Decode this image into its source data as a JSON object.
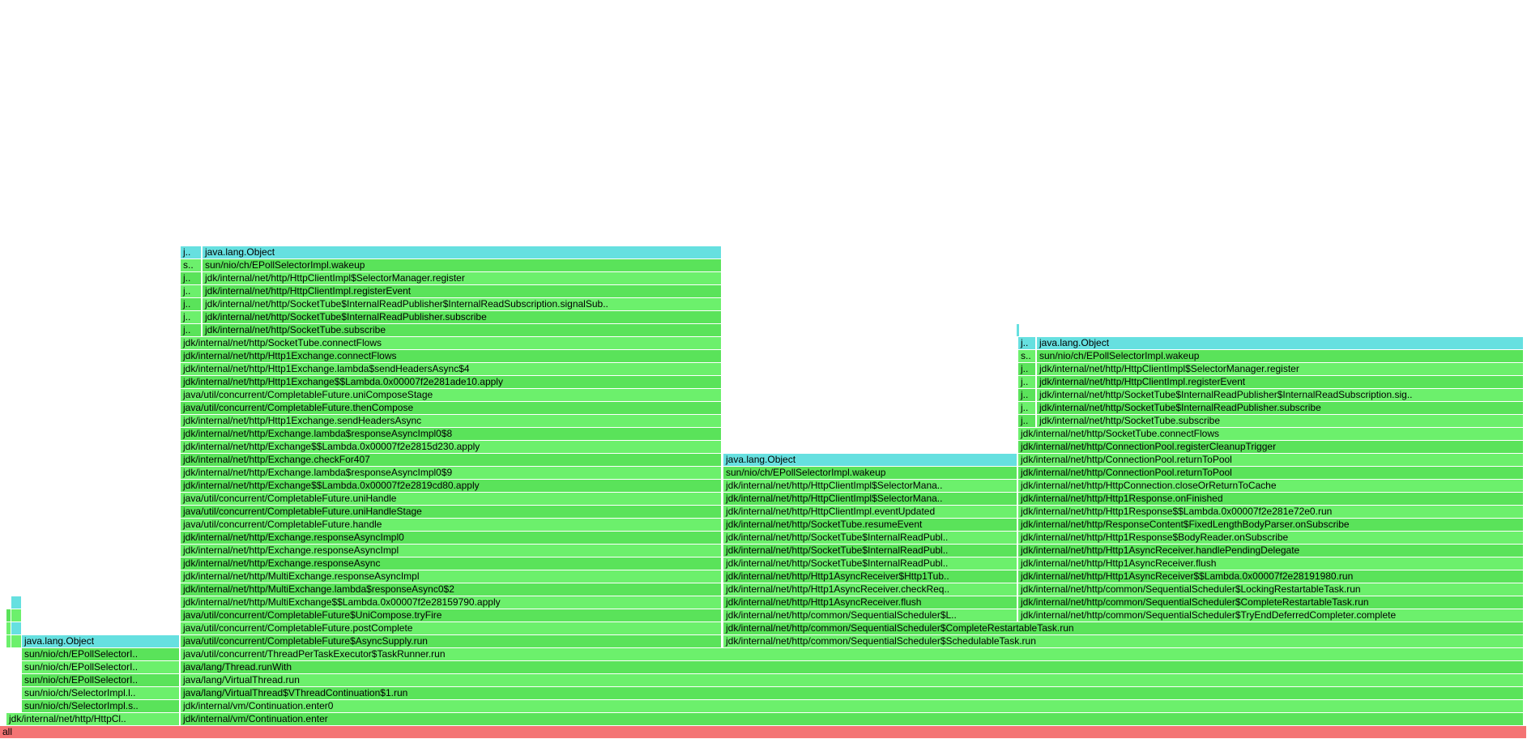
{
  "chart_data": {
    "type": "flamegraph",
    "title": "",
    "total_samples": 1885,
    "colors": {
      "java": "#6cf06c",
      "java_alt": "#5ae35a",
      "lock": "#66e0e0",
      "root": "#f47474"
    },
    "frames": [
      {
        "name": "all",
        "depth": 0,
        "start": 0,
        "width": 1885,
        "kind": "root"
      },
      {
        "name": "jdk/internal/net/http/HttpCl..",
        "depth": 1,
        "start": 8,
        "width": 214,
        "kind": "java"
      },
      {
        "name": "sun/nio/ch/SelectorImpl.s..",
        "depth": 2,
        "start": 27,
        "width": 195,
        "kind": "java_alt"
      },
      {
        "name": "sun/nio/ch/SelectorImpl.l..",
        "depth": 3,
        "start": 27,
        "width": 195,
        "kind": "java"
      },
      {
        "name": "sun/nio/ch/EPollSelectorI..",
        "depth": 4,
        "start": 27,
        "width": 195,
        "kind": "java_alt"
      },
      {
        "name": "sun/nio/ch/EPollSelectorI..",
        "depth": 5,
        "start": 27,
        "width": 195,
        "kind": "java"
      },
      {
        "name": "sun/nio/ch/EPollSelectorI..",
        "depth": 6,
        "start": 27,
        "width": 195,
        "kind": "java_alt"
      },
      {
        "name": "java.lang.Object",
        "depth": 7,
        "start": 27,
        "width": 195,
        "kind": "lock"
      },
      {
        "name": "",
        "depth": 7,
        "start": 8,
        "width": 6,
        "kind": "java"
      },
      {
        "name": "",
        "depth": 8,
        "start": 8,
        "width": 6,
        "kind": "java"
      },
      {
        "name": "",
        "depth": 9,
        "start": 8,
        "width": 6,
        "kind": "java_alt"
      },
      {
        "name": "",
        "depth": 7,
        "start": 14,
        "width": 13,
        "kind": "java"
      },
      {
        "name": "",
        "depth": 8,
        "start": 14,
        "width": 13,
        "kind": "lock"
      },
      {
        "name": "",
        "depth": 9,
        "start": 14,
        "width": 13,
        "kind": "java"
      },
      {
        "name": "",
        "depth": 10,
        "start": 14,
        "width": 13,
        "kind": "lock"
      },
      {
        "name": "jdk/internal/vm/Continuation.enter",
        "depth": 1,
        "start": 223,
        "width": 1658,
        "kind": "java_alt"
      },
      {
        "name": "jdk/internal/vm/Continuation.enter0",
        "depth": 2,
        "start": 223,
        "width": 1658,
        "kind": "java"
      },
      {
        "name": "java/lang/VirtualThread$VThreadContinuation$1.run",
        "depth": 3,
        "start": 223,
        "width": 1658,
        "kind": "java_alt"
      },
      {
        "name": "java/lang/VirtualThread.run",
        "depth": 4,
        "start": 223,
        "width": 1658,
        "kind": "java"
      },
      {
        "name": "java/lang/Thread.runWith",
        "depth": 5,
        "start": 223,
        "width": 1658,
        "kind": "java_alt"
      },
      {
        "name": "java/util/concurrent/ThreadPerTaskExecutor$TaskRunner.run",
        "depth": 6,
        "start": 223,
        "width": 1658,
        "kind": "java"
      },
      {
        "name": "java/util/concurrent/CompletableFuture$AsyncSupply.run",
        "depth": 7,
        "start": 223,
        "width": 668,
        "kind": "java_alt"
      },
      {
        "name": "java/util/concurrent/CompletableFuture.postComplete",
        "depth": 8,
        "start": 223,
        "width": 668,
        "kind": "java"
      },
      {
        "name": "java/util/concurrent/CompletableFuture$UniCompose.tryFire",
        "depth": 9,
        "start": 223,
        "width": 668,
        "kind": "java_alt"
      },
      {
        "name": "jdk/internal/net/http/MultiExchange$$Lambda.0x00007f2e28159790.apply",
        "depth": 10,
        "start": 223,
        "width": 668,
        "kind": "java"
      },
      {
        "name": "jdk/internal/net/http/MultiExchange.lambda$responseAsync0$2",
        "depth": 11,
        "start": 223,
        "width": 668,
        "kind": "java_alt"
      },
      {
        "name": "jdk/internal/net/http/MultiExchange.responseAsyncImpl",
        "depth": 12,
        "start": 223,
        "width": 668,
        "kind": "java"
      },
      {
        "name": "jdk/internal/net/http/Exchange.responseAsync",
        "depth": 13,
        "start": 223,
        "width": 668,
        "kind": "java_alt"
      },
      {
        "name": "jdk/internal/net/http/Exchange.responseAsyncImpl",
        "depth": 14,
        "start": 223,
        "width": 668,
        "kind": "java"
      },
      {
        "name": "jdk/internal/net/http/Exchange.responseAsyncImpl0",
        "depth": 15,
        "start": 223,
        "width": 668,
        "kind": "java_alt"
      },
      {
        "name": "java/util/concurrent/CompletableFuture.handle",
        "depth": 16,
        "start": 223,
        "width": 668,
        "kind": "java"
      },
      {
        "name": "java/util/concurrent/CompletableFuture.uniHandleStage",
        "depth": 17,
        "start": 223,
        "width": 668,
        "kind": "java_alt"
      },
      {
        "name": "java/util/concurrent/CompletableFuture.uniHandle",
        "depth": 18,
        "start": 223,
        "width": 668,
        "kind": "java"
      },
      {
        "name": "jdk/internal/net/http/Exchange$$Lambda.0x00007f2e2819cd80.apply",
        "depth": 19,
        "start": 223,
        "width": 668,
        "kind": "java_alt"
      },
      {
        "name": "jdk/internal/net/http/Exchange.lambda$responseAsyncImpl0$9",
        "depth": 20,
        "start": 223,
        "width": 668,
        "kind": "java"
      },
      {
        "name": "jdk/internal/net/http/Exchange.checkFor407",
        "depth": 21,
        "start": 223,
        "width": 668,
        "kind": "java_alt"
      },
      {
        "name": "jdk/internal/net/http/Exchange$$Lambda.0x00007f2e2815d230.apply",
        "depth": 22,
        "start": 223,
        "width": 668,
        "kind": "java"
      },
      {
        "name": "jdk/internal/net/http/Exchange.lambda$responseAsyncImpl0$8",
        "depth": 23,
        "start": 223,
        "width": 668,
        "kind": "java_alt"
      },
      {
        "name": "jdk/internal/net/http/Http1Exchange.sendHeadersAsync",
        "depth": 24,
        "start": 223,
        "width": 668,
        "kind": "java"
      },
      {
        "name": "java/util/concurrent/CompletableFuture.thenCompose",
        "depth": 25,
        "start": 223,
        "width": 668,
        "kind": "java_alt"
      },
      {
        "name": "java/util/concurrent/CompletableFuture.uniComposeStage",
        "depth": 26,
        "start": 223,
        "width": 668,
        "kind": "java"
      },
      {
        "name": "jdk/internal/net/http/Http1Exchange$$Lambda.0x00007f2e281ade10.apply",
        "depth": 27,
        "start": 223,
        "width": 668,
        "kind": "java_alt"
      },
      {
        "name": "jdk/internal/net/http/Http1Exchange.lambda$sendHeadersAsync$4",
        "depth": 28,
        "start": 223,
        "width": 668,
        "kind": "java"
      },
      {
        "name": "jdk/internal/net/http/Http1Exchange.connectFlows",
        "depth": 29,
        "start": 223,
        "width": 668,
        "kind": "java_alt"
      },
      {
        "name": "jdk/internal/net/http/SocketTube.connectFlows",
        "depth": 30,
        "start": 223,
        "width": 668,
        "kind": "java"
      },
      {
        "name": "j..",
        "depth": 31,
        "start": 223,
        "width": 26,
        "kind": "java_alt"
      },
      {
        "name": "jdk/internal/net/http/SocketTube.subscribe",
        "depth": 31,
        "start": 250,
        "width": 641,
        "kind": "java_alt"
      },
      {
        "name": "j..",
        "depth": 32,
        "start": 223,
        "width": 26,
        "kind": "java"
      },
      {
        "name": "jdk/internal/net/http/SocketTube$InternalReadPublisher.subscribe",
        "depth": 32,
        "start": 250,
        "width": 641,
        "kind": "java_alt"
      },
      {
        "name": "j..",
        "depth": 33,
        "start": 223,
        "width": 26,
        "kind": "java_alt"
      },
      {
        "name": "jdk/internal/net/http/SocketTube$InternalReadPublisher$InternalReadSubscription.signalSub..",
        "depth": 33,
        "start": 250,
        "width": 641,
        "kind": "java"
      },
      {
        "name": "j..",
        "depth": 34,
        "start": 223,
        "width": 26,
        "kind": "java"
      },
      {
        "name": "jdk/internal/net/http/HttpClientImpl.registerEvent",
        "depth": 34,
        "start": 250,
        "width": 641,
        "kind": "java_alt"
      },
      {
        "name": "j..",
        "depth": 35,
        "start": 223,
        "width": 26,
        "kind": "java_alt"
      },
      {
        "name": "jdk/internal/net/http/HttpClientImpl$SelectorManager.register",
        "depth": 35,
        "start": 250,
        "width": 641,
        "kind": "java"
      },
      {
        "name": "s..",
        "depth": 36,
        "start": 223,
        "width": 26,
        "kind": "java"
      },
      {
        "name": "sun/nio/ch/EPollSelectorImpl.wakeup",
        "depth": 36,
        "start": 250,
        "width": 641,
        "kind": "java_alt"
      },
      {
        "name": "j..",
        "depth": 37,
        "start": 223,
        "width": 26,
        "kind": "lock"
      },
      {
        "name": "java.lang.Object",
        "depth": 37,
        "start": 250,
        "width": 641,
        "kind": "lock"
      },
      {
        "name": "jdk/internal/net/http/common/SequentialScheduler$SchedulableTask.run",
        "depth": 7,
        "start": 893,
        "width": 988,
        "kind": "java"
      },
      {
        "name": "jdk/internal/net/http/common/SequentialScheduler$CompleteRestartableTask.run",
        "depth": 8,
        "start": 893,
        "width": 988,
        "kind": "java_alt"
      },
      {
        "name": "jdk/internal/net/http/common/SequentialScheduler$L..",
        "depth": 9,
        "start": 893,
        "width": 363,
        "kind": "java"
      },
      {
        "name": "jdk/internal/net/http/Http1AsyncReceiver.flush",
        "depth": 10,
        "start": 893,
        "width": 363,
        "kind": "java_alt"
      },
      {
        "name": "jdk/internal/net/http/Http1AsyncReceiver.checkReq..",
        "depth": 11,
        "start": 893,
        "width": 363,
        "kind": "java"
      },
      {
        "name": "jdk/internal/net/http/Http1AsyncReceiver$Http1Tub..",
        "depth": 12,
        "start": 893,
        "width": 363,
        "kind": "java_alt"
      },
      {
        "name": "jdk/internal/net/http/SocketTube$InternalReadPubl..",
        "depth": 13,
        "start": 893,
        "width": 363,
        "kind": "java"
      },
      {
        "name": "jdk/internal/net/http/SocketTube$InternalReadPubl..",
        "depth": 14,
        "start": 893,
        "width": 363,
        "kind": "java_alt"
      },
      {
        "name": "jdk/internal/net/http/SocketTube$InternalReadPubl..",
        "depth": 15,
        "start": 893,
        "width": 363,
        "kind": "java"
      },
      {
        "name": "jdk/internal/net/http/SocketTube.resumeEvent",
        "depth": 16,
        "start": 893,
        "width": 363,
        "kind": "java_alt"
      },
      {
        "name": "jdk/internal/net/http/HttpClientImpl.eventUpdated",
        "depth": 17,
        "start": 893,
        "width": 363,
        "kind": "java"
      },
      {
        "name": "jdk/internal/net/http/HttpClientImpl$SelectorMana..",
        "depth": 18,
        "start": 893,
        "width": 363,
        "kind": "java_alt"
      },
      {
        "name": "jdk/internal/net/http/HttpClientImpl$SelectorMana..",
        "depth": 19,
        "start": 893,
        "width": 363,
        "kind": "java"
      },
      {
        "name": "sun/nio/ch/EPollSelectorImpl.wakeup",
        "depth": 20,
        "start": 893,
        "width": 363,
        "kind": "java_alt"
      },
      {
        "name": "java.lang.Object",
        "depth": 21,
        "start": 893,
        "width": 363,
        "kind": "lock"
      },
      {
        "name": "jdk/internal/net/http/common/SequentialScheduler$TryEndDeferredCompleter.complete",
        "depth": 9,
        "start": 1257,
        "width": 624,
        "kind": "java"
      },
      {
        "name": "jdk/internal/net/http/common/SequentialScheduler$CompleteRestartableTask.run",
        "depth": 10,
        "start": 1257,
        "width": 624,
        "kind": "java_alt"
      },
      {
        "name": "jdk/internal/net/http/common/SequentialScheduler$LockingRestartableTask.run",
        "depth": 11,
        "start": 1257,
        "width": 624,
        "kind": "java"
      },
      {
        "name": "jdk/internal/net/http/Http1AsyncReceiver$$Lambda.0x00007f2e28191980.run",
        "depth": 12,
        "start": 1257,
        "width": 624,
        "kind": "java_alt"
      },
      {
        "name": "jdk/internal/net/http/Http1AsyncReceiver.flush",
        "depth": 13,
        "start": 1257,
        "width": 624,
        "kind": "java"
      },
      {
        "name": "jdk/internal/net/http/Http1AsyncReceiver.handlePendingDelegate",
        "depth": 14,
        "start": 1257,
        "width": 624,
        "kind": "java_alt"
      },
      {
        "name": "jdk/internal/net/http/Http1Response$BodyReader.onSubscribe",
        "depth": 15,
        "start": 1257,
        "width": 624,
        "kind": "java"
      },
      {
        "name": "jdk/internal/net/http/ResponseContent$FixedLengthBodyParser.onSubscribe",
        "depth": 16,
        "start": 1257,
        "width": 624,
        "kind": "java_alt"
      },
      {
        "name": "jdk/internal/net/http/Http1Response$$Lambda.0x00007f2e281e72e0.run",
        "depth": 17,
        "start": 1257,
        "width": 624,
        "kind": "java"
      },
      {
        "name": "jdk/internal/net/http/Http1Response.onFinished",
        "depth": 18,
        "start": 1257,
        "width": 624,
        "kind": "java_alt"
      },
      {
        "name": "jdk/internal/net/http/HttpConnection.closeOrReturnToCache",
        "depth": 19,
        "start": 1257,
        "width": 624,
        "kind": "java"
      },
      {
        "name": "jdk/internal/net/http/ConnectionPool.returnToPool",
        "depth": 20,
        "start": 1257,
        "width": 624,
        "kind": "java_alt"
      },
      {
        "name": "jdk/internal/net/http/ConnectionPool.returnToPool",
        "depth": 21,
        "start": 1257,
        "width": 624,
        "kind": "java"
      },
      {
        "name": "jdk/internal/net/http/ConnectionPool.registerCleanupTrigger",
        "depth": 22,
        "start": 1257,
        "width": 624,
        "kind": "java_alt"
      },
      {
        "name": "jdk/internal/net/http/SocketTube.connectFlows",
        "depth": 23,
        "start": 1257,
        "width": 624,
        "kind": "java"
      },
      {
        "name": "j..",
        "depth": 24,
        "start": 1257,
        "width": 22,
        "kind": "java_alt"
      },
      {
        "name": "jdk/internal/net/http/SocketTube.subscribe",
        "depth": 24,
        "start": 1280,
        "width": 601,
        "kind": "java"
      },
      {
        "name": "j..",
        "depth": 25,
        "start": 1257,
        "width": 22,
        "kind": "java"
      },
      {
        "name": "jdk/internal/net/http/SocketTube$InternalReadPublisher.subscribe",
        "depth": 25,
        "start": 1280,
        "width": 601,
        "kind": "java_alt"
      },
      {
        "name": "j..",
        "depth": 26,
        "start": 1257,
        "width": 22,
        "kind": "java_alt"
      },
      {
        "name": "jdk/internal/net/http/SocketTube$InternalReadPublisher$InternalReadSubscription.sig..",
        "depth": 26,
        "start": 1280,
        "width": 601,
        "kind": "java"
      },
      {
        "name": "j..",
        "depth": 27,
        "start": 1257,
        "width": 22,
        "kind": "java"
      },
      {
        "name": "jdk/internal/net/http/HttpClientImpl.registerEvent",
        "depth": 27,
        "start": 1280,
        "width": 601,
        "kind": "java_alt"
      },
      {
        "name": "j..",
        "depth": 28,
        "start": 1257,
        "width": 22,
        "kind": "java_alt"
      },
      {
        "name": "jdk/internal/net/http/HttpClientImpl$SelectorManager.register",
        "depth": 28,
        "start": 1280,
        "width": 601,
        "kind": "java"
      },
      {
        "name": "s..",
        "depth": 29,
        "start": 1257,
        "width": 22,
        "kind": "java"
      },
      {
        "name": "sun/nio/ch/EPollSelectorImpl.wakeup",
        "depth": 29,
        "start": 1280,
        "width": 601,
        "kind": "java_alt"
      },
      {
        "name": "j..",
        "depth": 30,
        "start": 1257,
        "width": 22,
        "kind": "lock"
      },
      {
        "name": "java.lang.Object",
        "depth": 30,
        "start": 1280,
        "width": 601,
        "kind": "lock"
      },
      {
        "name": "",
        "depth": 31,
        "start": 1255,
        "width": 2,
        "kind": "lock"
      }
    ]
  }
}
